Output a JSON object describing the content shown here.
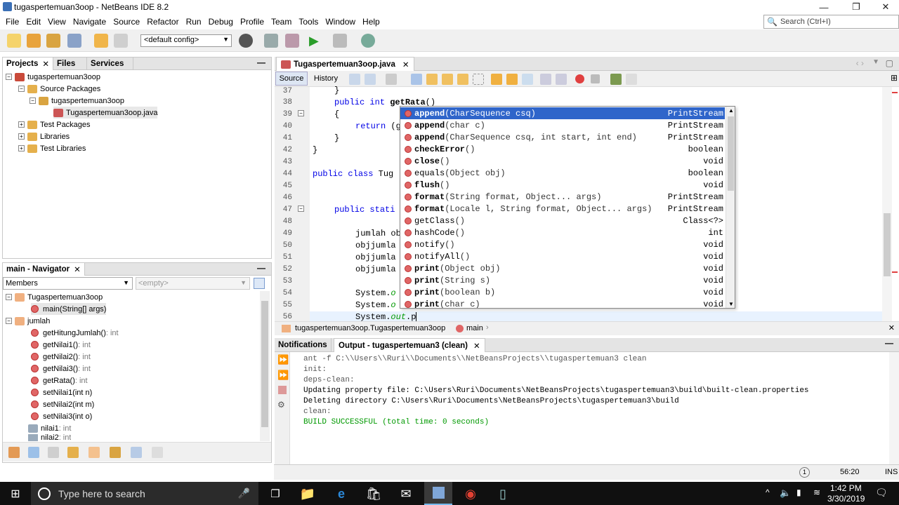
{
  "window": {
    "title": "tugaspertemuan3oop - NetBeans IDE 8.2",
    "minimize": "—",
    "maximize": "❐",
    "close": "✕"
  },
  "menu": [
    "File",
    "Edit",
    "View",
    "Navigate",
    "Source",
    "Refactor",
    "Run",
    "Debug",
    "Profile",
    "Team",
    "Tools",
    "Window",
    "Help"
  ],
  "search": {
    "placeholder": "Search (Ctrl+I)"
  },
  "toolbar": {
    "config": "<default config>"
  },
  "projects": {
    "tabs": [
      "Projects",
      "Files",
      "Services"
    ],
    "tree": [
      {
        "label": "tugaspertemuan3oop"
      },
      {
        "label": "Source Packages"
      },
      {
        "label": "tugaspertemuan3oop"
      },
      {
        "label": "Tugaspertemuan3oop.java"
      },
      {
        "label": "Test Packages"
      },
      {
        "label": "Libraries"
      },
      {
        "label": "Test Libraries"
      }
    ]
  },
  "navigator": {
    "title": "main - Navigator",
    "members": "Members",
    "filter": "<empty>",
    "items": [
      {
        "name": "Tugaspertemuan3oop",
        "type": ""
      },
      {
        "name": "main(String[] args)",
        "type": ""
      },
      {
        "name": "jumlah",
        "type": ""
      },
      {
        "name": "getHitungJumlah()",
        "type": " : int"
      },
      {
        "name": "getNilai1()",
        "type": " : int"
      },
      {
        "name": "getNilai2()",
        "type": " : int"
      },
      {
        "name": "getNilai3()",
        "type": " : int"
      },
      {
        "name": "getRata()",
        "type": " : int"
      },
      {
        "name": "setNilai1(int n)",
        "type": ""
      },
      {
        "name": "setNilai2(int m)",
        "type": ""
      },
      {
        "name": "setNilai3(int o)",
        "type": ""
      },
      {
        "name": "nilai1",
        "type": " : int"
      },
      {
        "name": "nilai2",
        "type": " : int"
      }
    ]
  },
  "editor": {
    "file_tab": "Tugaspertemuan3oop.java",
    "source_tab": "Source",
    "history_tab": "History",
    "lines": [
      "37",
      "38",
      "39",
      "40",
      "41",
      "42",
      "43",
      "44",
      "45",
      "46",
      "47",
      "48",
      "49",
      "50",
      "51",
      "52",
      "53",
      "54",
      "55",
      "56"
    ],
    "breadcrumb_class": "tugaspertemuan3oop.Tugaspertemuan3oop",
    "breadcrumb_method": "main"
  },
  "completion": [
    {
      "name": "append",
      "params": "(CharSequence csq)",
      "ret": "PrintStream"
    },
    {
      "name": "append",
      "params": "(char c)",
      "ret": "PrintStream"
    },
    {
      "name": "append",
      "params": "(CharSequence csq, int start, int end)",
      "ret": "PrintStream"
    },
    {
      "name": "checkError",
      "params": "()",
      "ret": "boolean"
    },
    {
      "name": "close",
      "params": "()",
      "ret": "void"
    },
    {
      "name": "equals",
      "params": "(Object obj)",
      "ret": "boolean"
    },
    {
      "name": "flush",
      "params": "()",
      "ret": "void"
    },
    {
      "name": "format",
      "params": "(String format, Object... args)",
      "ret": "PrintStream"
    },
    {
      "name": "format",
      "params": "(Locale l, String format, Object... args)",
      "ret": "PrintStream"
    },
    {
      "name": "getClass",
      "params": "()",
      "ret": "Class<?>"
    },
    {
      "name": "hashCode",
      "params": "()",
      "ret": "int"
    },
    {
      "name": "notify",
      "params": "()",
      "ret": "void"
    },
    {
      "name": "notifyAll",
      "params": "()",
      "ret": "void"
    },
    {
      "name": "print",
      "params": "(Object obj)",
      "ret": "void"
    },
    {
      "name": "print",
      "params": "(String s)",
      "ret": "void"
    },
    {
      "name": "print",
      "params": "(boolean b)",
      "ret": "void"
    },
    {
      "name": "print",
      "params": "(char c)",
      "ret": "void"
    }
  ],
  "output": {
    "notifications_tab": "Notifications",
    "output_tab": "Output - tugaspertemuan3 (clean)",
    "lines": [
      "ant -f C:\\\\Users\\\\Ruri\\\\Documents\\\\NetBeansProjects\\\\tugaspertemuan3 clean",
      "init:",
      "deps-clean:",
      "Updating property file: C:\\Users\\Ruri\\Documents\\NetBeansProjects\\tugaspertemuan3\\build\\built-clean.properties",
      "Deleting directory C:\\Users\\Ruri\\Documents\\NetBeansProjects\\tugaspertemuan3\\build",
      "clean:",
      "BUILD SUCCESSFUL (total time: 0 seconds)"
    ]
  },
  "status": {
    "position": "56:20",
    "mode": "INS",
    "badge": "1"
  },
  "taskbar": {
    "search_placeholder": "Type here to search",
    "time": "1:42 PM",
    "date": "3/30/2019"
  }
}
